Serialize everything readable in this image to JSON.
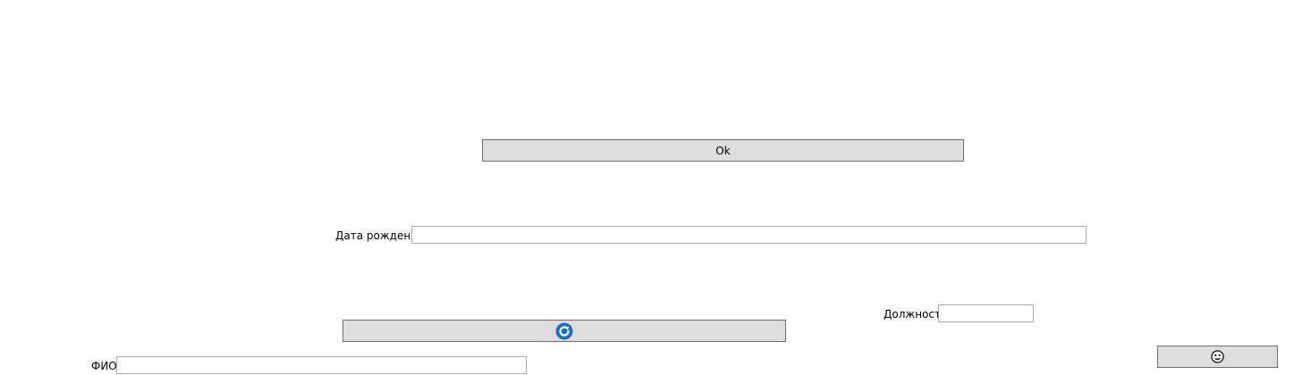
{
  "ok_button": {
    "label": "Ok"
  },
  "refresh_button": {
    "icon": "refresh-icon",
    "icon_color": "#1f6fbf"
  },
  "face_button": {
    "icon": "face-icon"
  },
  "birth_date": {
    "label": "Дата рождения",
    "value": "",
    "placeholder": ""
  },
  "position": {
    "label": "Должность",
    "value": "",
    "placeholder": ""
  },
  "fio": {
    "label": "ФИО",
    "value": "",
    "placeholder": ""
  },
  "colors": {
    "button_background": "#dddddd",
    "button_border": "#707070",
    "input_border": "#ababab"
  }
}
